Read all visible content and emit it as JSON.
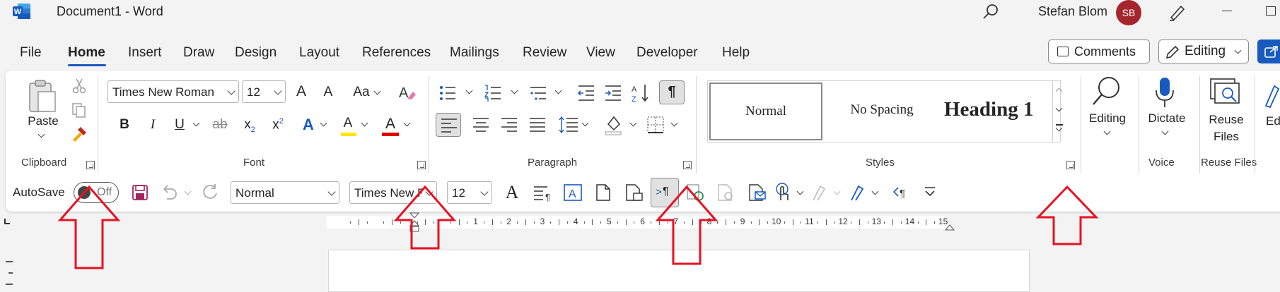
{
  "window": {
    "app_logo_letter": "W",
    "document_title": "Document1  -  Word",
    "user_name": "Stefan Blom",
    "user_initials": "SB"
  },
  "tabs": [
    {
      "label": "File"
    },
    {
      "label": "Home"
    },
    {
      "label": "Insert"
    },
    {
      "label": "Draw"
    },
    {
      "label": "Design"
    },
    {
      "label": "Layout"
    },
    {
      "label": "References"
    },
    {
      "label": "Mailings"
    },
    {
      "label": "Review"
    },
    {
      "label": "View"
    },
    {
      "label": "Developer"
    },
    {
      "label": "Help"
    }
  ],
  "header_buttons": {
    "comments": "Comments",
    "editing": "Editing"
  },
  "ribbon": {
    "clipboard": {
      "paste_label": "Paste",
      "group_label": "Clipboard"
    },
    "font": {
      "name": "Times New Roman",
      "size": "12",
      "grow_label": "A",
      "shrink_label": "A",
      "case_label": "Aa",
      "bold": "B",
      "italic": "I",
      "underline": "U",
      "strike": "ab",
      "subscript": "x",
      "subscript_small": "2",
      "superscript": "x",
      "superscript_small": "2",
      "text_effects": "A",
      "highlight": "A",
      "font_color": "A",
      "group_label": "Font"
    },
    "paragraph": {
      "group_label": "Paragraph",
      "pilcrow": "¶"
    },
    "styles": {
      "items": [
        "Normal",
        "No Spacing",
        "Heading 1"
      ],
      "group_label": "Styles"
    },
    "editing": {
      "label": "Editing"
    },
    "voice": {
      "dictate_label": "Dictate",
      "group_label": "Voice"
    },
    "reuse": {
      "label_line1": "Reuse",
      "label_line2": "Files",
      "group_label": "Reuse Files"
    },
    "edge_label": "Ed"
  },
  "qat": {
    "autosave_label": "AutoSave",
    "autosave_state": "Off",
    "style_value": "Normal",
    "font_value": "Times New R",
    "size_value": "12",
    "font_glyph": "A",
    "show_marks": "¶"
  },
  "ruler": {
    "numbers": [
      "1",
      "2",
      "3",
      "4",
      "5",
      "6",
      "7",
      "8",
      "9",
      "10",
      "11",
      "12",
      "13",
      "14",
      "15"
    ]
  },
  "colors": {
    "accent": "#185abd",
    "avatar": "#a4262c",
    "annotation_arrow": "#e81123",
    "highlight": "#ffe600",
    "font_color": "#e00000"
  }
}
